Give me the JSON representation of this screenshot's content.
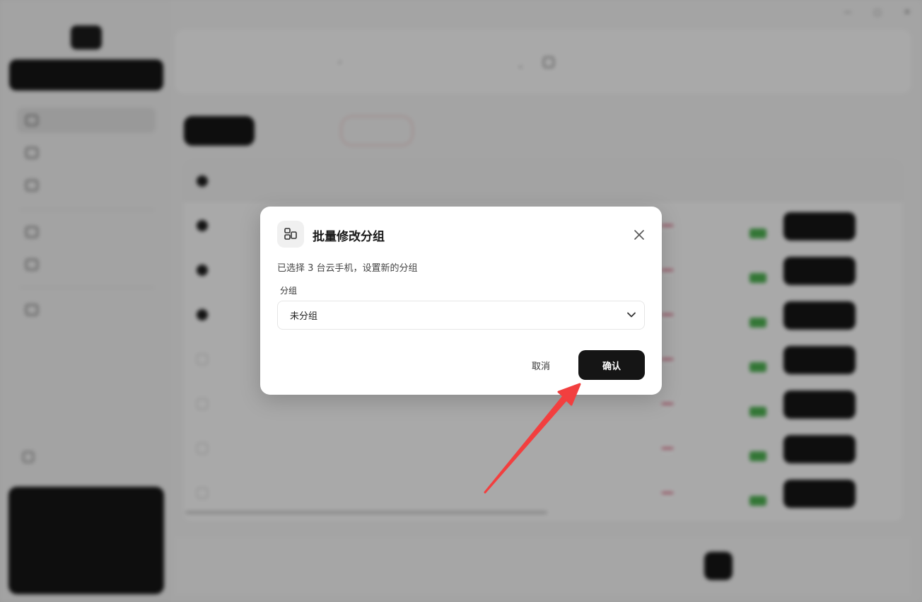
{
  "colors": {
    "primary": "#151515",
    "danger": "#d35c5c",
    "annotation_arrow": "#f23f3f",
    "status_green": "#4caf50"
  },
  "modal": {
    "icon": "group-edit-icon",
    "title": "批量修改分组",
    "description": "已选择 3 台云手机，设置新的分组",
    "field_label": "分组",
    "selected_value": "未分组",
    "cancel_label": "取消",
    "confirm_label": "确认"
  },
  "annotation": {
    "type": "red-arrow",
    "points_to": "confirm-button"
  }
}
